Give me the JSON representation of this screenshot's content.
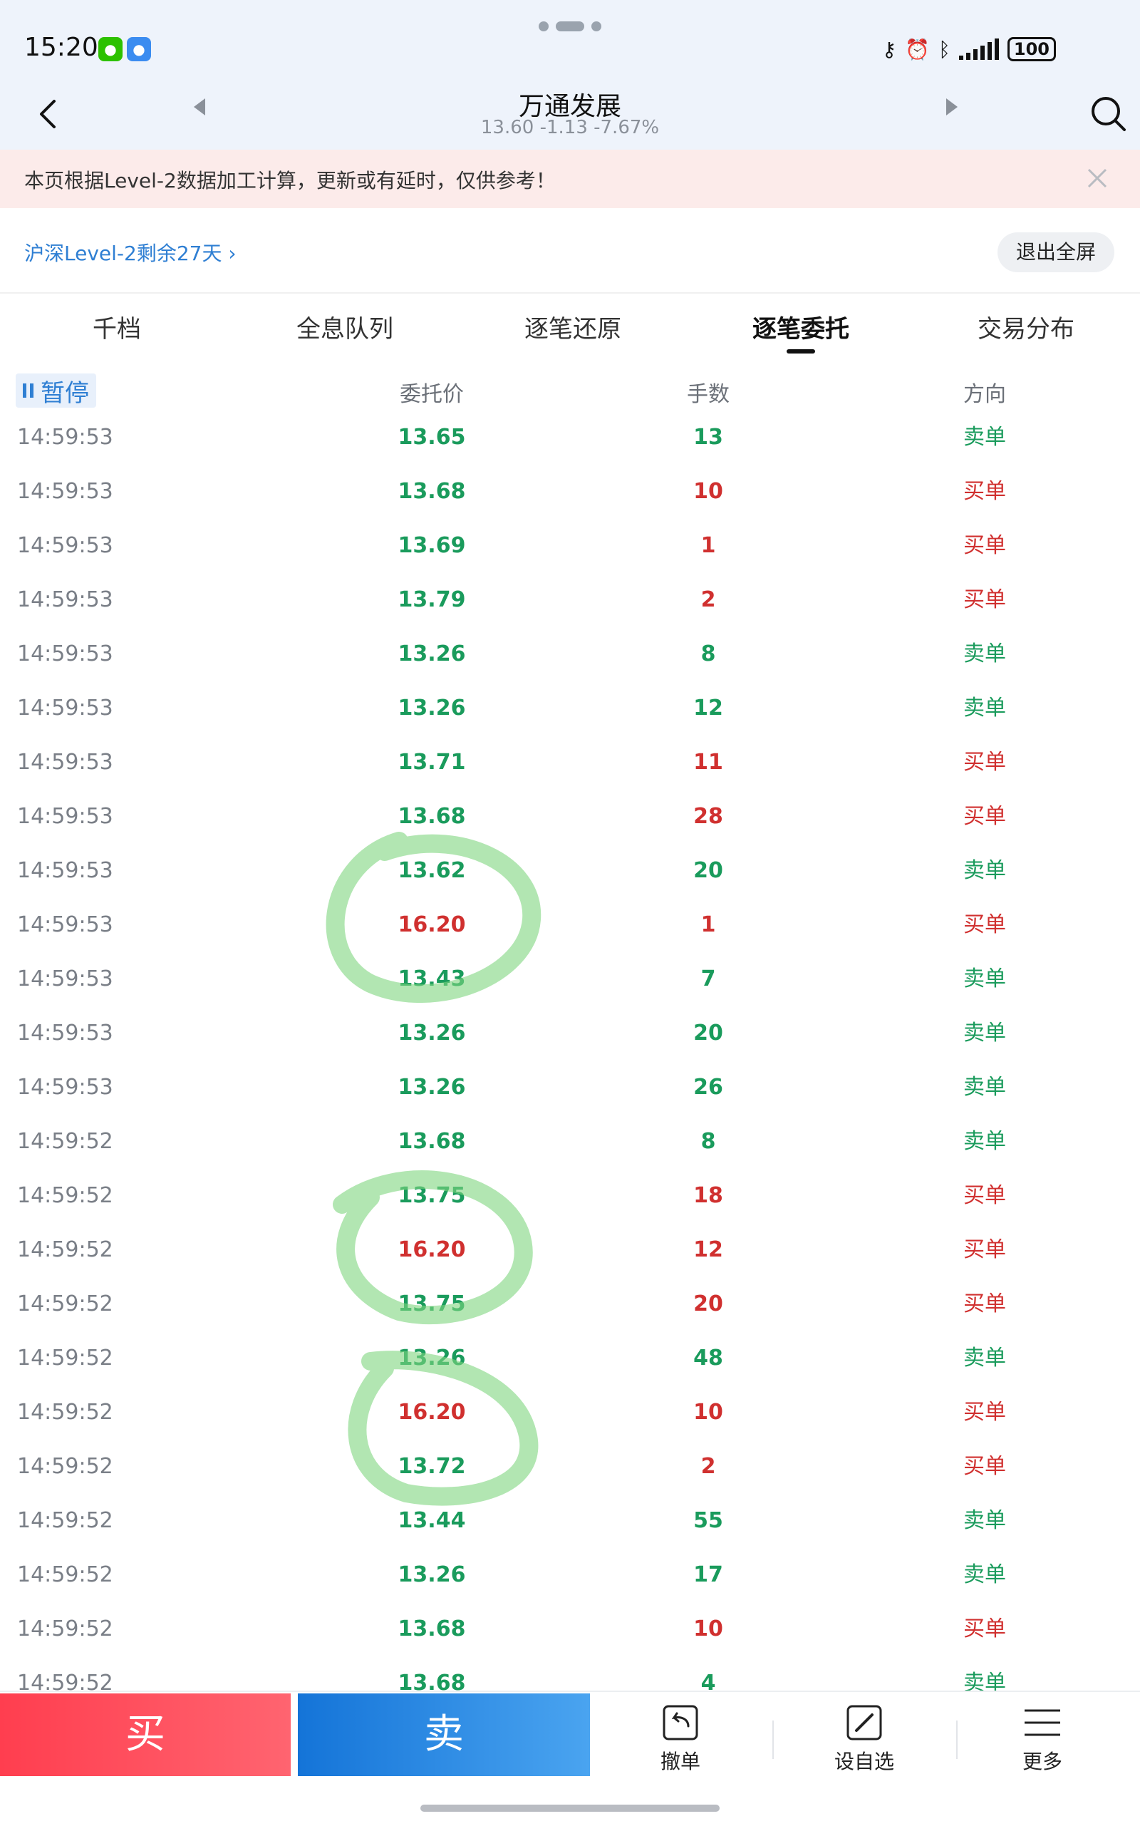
{
  "status_bar": {
    "time": "15:20",
    "battery": "100",
    "icons": [
      "wechat-icon",
      "message-icon",
      "key-icon",
      "alarm-icon",
      "bluetooth-vibrate-icon",
      "signal-icon",
      "battery-icon"
    ]
  },
  "header": {
    "title": "万通发展",
    "quote": "13.60  -1.13  -7.67%",
    "icons": [
      "back-icon",
      "prev-stock-icon",
      "next-stock-icon",
      "search-icon"
    ]
  },
  "notice": {
    "text": "本页根据Level-2数据加工计算，更新或有延时，仅供参考！"
  },
  "level2": {
    "link": "沪深Level-2剩余27天",
    "exit_fullscreen": "退出全屏"
  },
  "tabs": [
    {
      "label": "千档",
      "active": false
    },
    {
      "label": "全息队列",
      "active": false
    },
    {
      "label": "逐笔还原",
      "active": false
    },
    {
      "label": "逐笔委托",
      "active": true
    },
    {
      "label": "交易分布",
      "active": false
    }
  ],
  "columns": {
    "pause": "暂停",
    "price": "委托价",
    "qty": "手数",
    "direction": "方向"
  },
  "colors": {
    "up": "#d0302f",
    "down": "#1a9b5c",
    "accent": "#2f7fd3",
    "buy": "#ff3e4f",
    "sell": "#1474d8",
    "highlight": "#7ed67e"
  },
  "rows": [
    {
      "time": "14:59:53",
      "price": "13.65",
      "qty": "13",
      "dir": "卖单"
    },
    {
      "time": "14:59:53",
      "price": "13.68",
      "qty": "10",
      "dir": "买单"
    },
    {
      "time": "14:59:53",
      "price": "13.69",
      "qty": "1",
      "dir": "买单"
    },
    {
      "time": "14:59:53",
      "price": "13.79",
      "qty": "2",
      "dir": "买单"
    },
    {
      "time": "14:59:53",
      "price": "13.26",
      "qty": "8",
      "dir": "卖单"
    },
    {
      "time": "14:59:53",
      "price": "13.26",
      "qty": "12",
      "dir": "卖单"
    },
    {
      "time": "14:59:53",
      "price": "13.71",
      "qty": "11",
      "dir": "买单"
    },
    {
      "time": "14:59:53",
      "price": "13.68",
      "qty": "28",
      "dir": "买单"
    },
    {
      "time": "14:59:53",
      "price": "13.62",
      "qty": "20",
      "dir": "卖单"
    },
    {
      "time": "14:59:53",
      "price": "16.20",
      "qty": "1",
      "dir": "买单"
    },
    {
      "time": "14:59:53",
      "price": "13.43",
      "qty": "7",
      "dir": "卖单"
    },
    {
      "time": "14:59:53",
      "price": "13.26",
      "qty": "20",
      "dir": "卖单"
    },
    {
      "time": "14:59:53",
      "price": "13.26",
      "qty": "26",
      "dir": "卖单"
    },
    {
      "time": "14:59:52",
      "price": "13.68",
      "qty": "8",
      "dir": "卖单"
    },
    {
      "time": "14:59:52",
      "price": "13.75",
      "qty": "18",
      "dir": "买单"
    },
    {
      "time": "14:59:52",
      "price": "16.20",
      "qty": "12",
      "dir": "买单"
    },
    {
      "time": "14:59:52",
      "price": "13.75",
      "qty": "20",
      "dir": "买单"
    },
    {
      "time": "14:59:52",
      "price": "13.26",
      "qty": "48",
      "dir": "卖单"
    },
    {
      "time": "14:59:52",
      "price": "16.20",
      "qty": "10",
      "dir": "买单"
    },
    {
      "time": "14:59:52",
      "price": "13.72",
      "qty": "2",
      "dir": "买单"
    },
    {
      "time": "14:59:52",
      "price": "13.44",
      "qty": "55",
      "dir": "卖单"
    },
    {
      "time": "14:59:52",
      "price": "13.26",
      "qty": "17",
      "dir": "卖单"
    },
    {
      "time": "14:59:52",
      "price": "13.68",
      "qty": "10",
      "dir": "买单"
    },
    {
      "time": "14:59:52",
      "price": "13.68",
      "qty": "4",
      "dir": "卖单"
    }
  ],
  "bottom": {
    "buy": "买",
    "sell": "卖",
    "tools": [
      {
        "label": "撤单",
        "icon": "cancel-order-icon"
      },
      {
        "label": "设自选",
        "icon": "edit-watchlist-icon"
      },
      {
        "label": "更多",
        "icon": "menu-icon"
      }
    ]
  }
}
